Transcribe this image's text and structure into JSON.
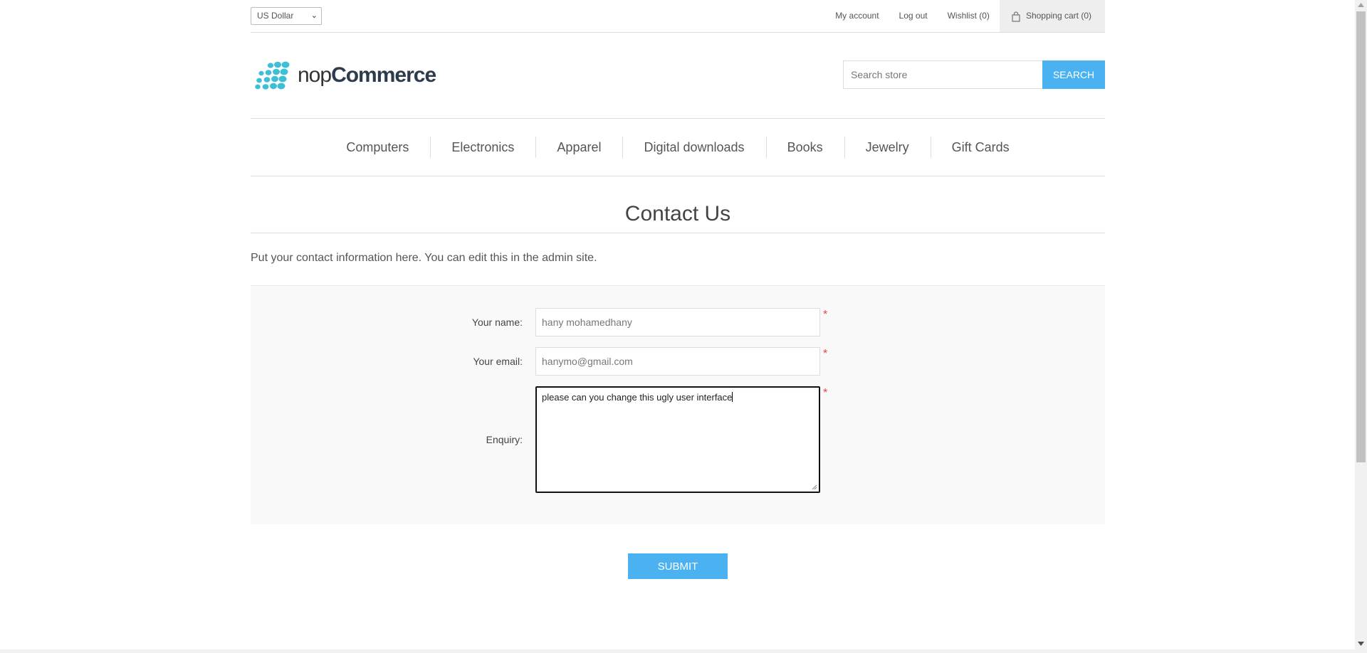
{
  "header": {
    "currency_selected": "US Dollar",
    "links": {
      "my_account": "My account",
      "log_out": "Log out",
      "wishlist": "Wishlist (0)",
      "shopping_cart": "Shopping cart (0)"
    }
  },
  "logo": {
    "text_light": "nop",
    "text_bold": "Commerce",
    "brand_color": "#3dbfd6"
  },
  "search": {
    "placeholder": "Search store",
    "button_label": "Search"
  },
  "menu": {
    "items": [
      "Computers",
      "Electronics",
      "Apparel",
      "Digital downloads",
      "Books",
      "Jewelry",
      "Gift Cards"
    ]
  },
  "page": {
    "title": "Contact Us",
    "topic_text": "Put your contact information here. You can edit this in the admin site."
  },
  "form": {
    "name_label": "Your name:",
    "name_value": "hany mohamedhany",
    "email_label": "Your email:",
    "email_value": "hanymo@gmail.com",
    "enquiry_label": "Enquiry:",
    "enquiry_value": "please can you change this ugly user interface",
    "required_mark": "*",
    "submit_label": "Submit"
  },
  "colors": {
    "accent": "#4ab2f1",
    "required": "#e4434b",
    "panel_bg": "#f9f9f9"
  }
}
